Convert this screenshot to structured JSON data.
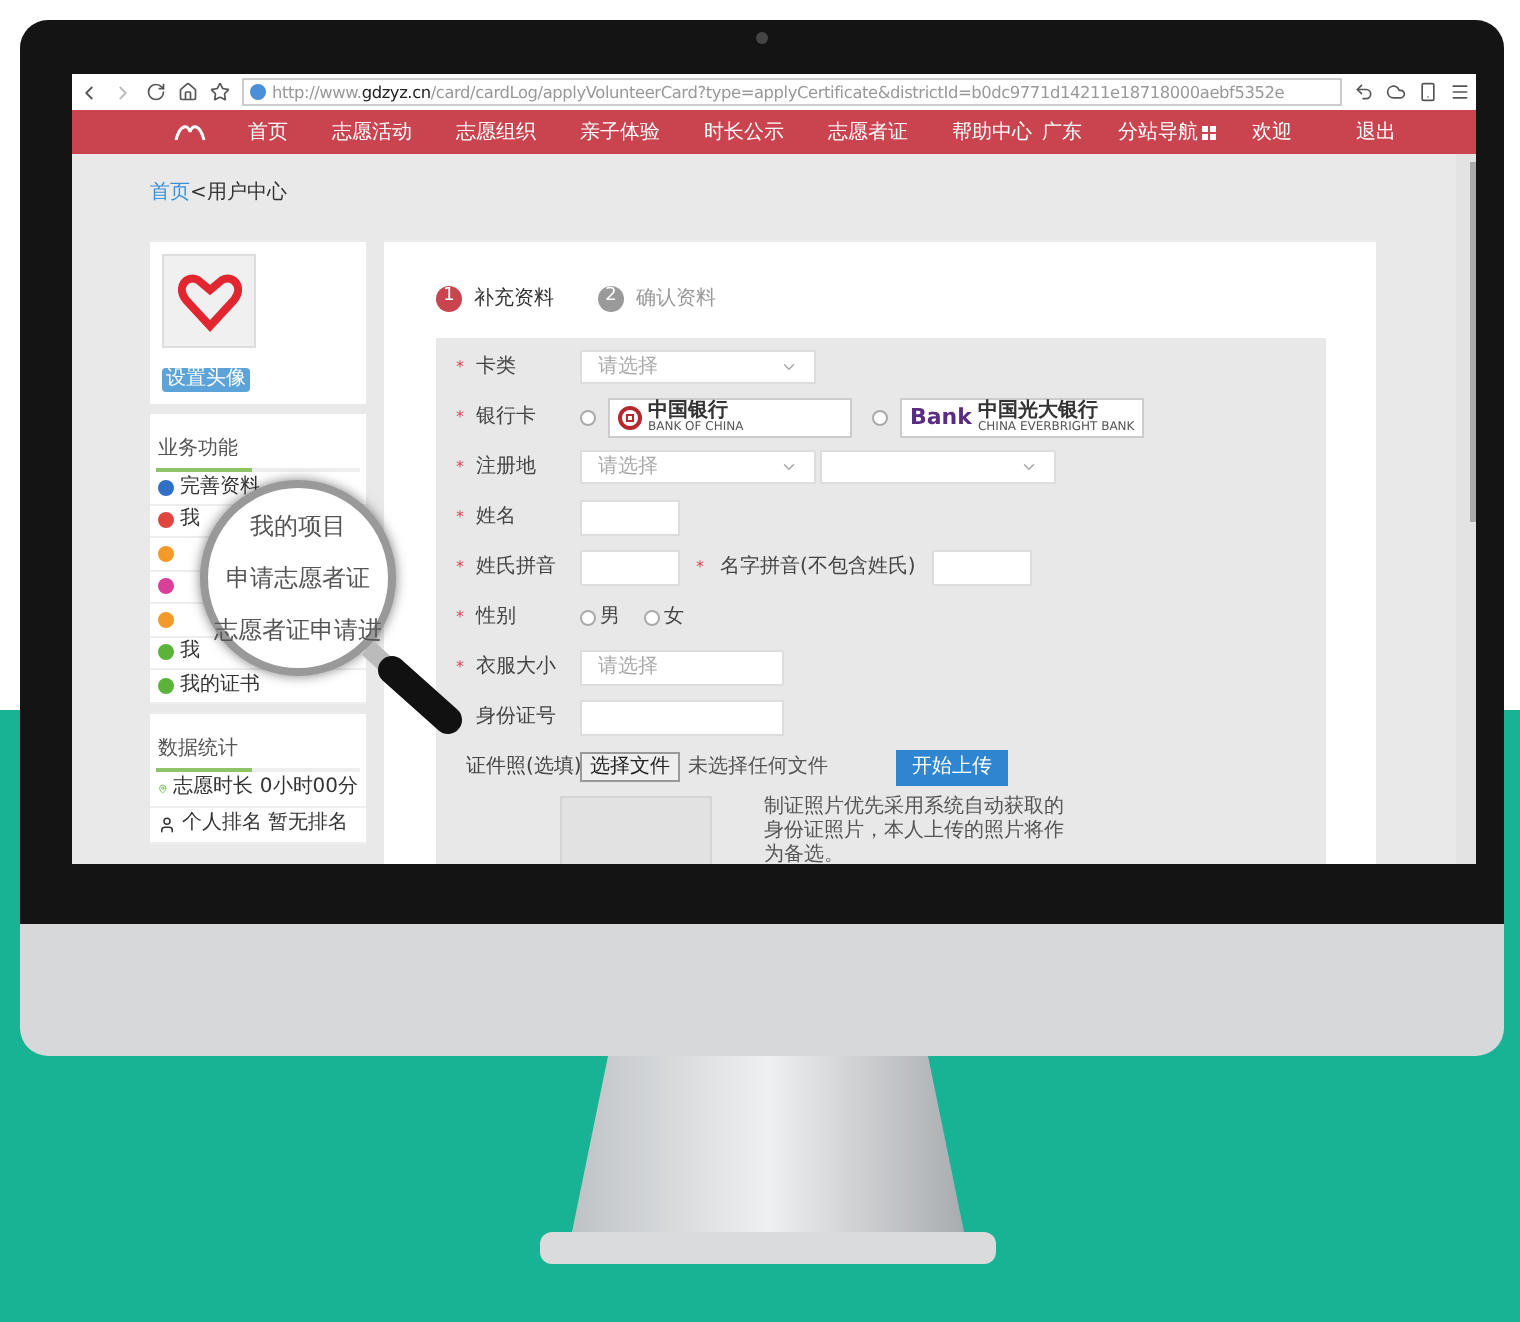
{
  "browser": {
    "url_host": "http://www.",
    "url_domain": "gdzyz.cn",
    "url_path": "/card/cardLog/applyVolunteerCard?type=applyCertificate&districtId=b0dc9771d14211e18718000aebf5352e"
  },
  "nav": {
    "items": [
      {
        "label": "首页"
      },
      {
        "label": "志愿活动"
      },
      {
        "label": "志愿组织"
      },
      {
        "label": "亲子体验"
      },
      {
        "label": "时长公示"
      },
      {
        "label": "志愿者证"
      },
      {
        "label": "帮助中心"
      }
    ],
    "region": "广东",
    "site_nav": "分站导航",
    "welcome": "欢迎",
    "logout": "退出"
  },
  "breadcrumb": {
    "home": "首页",
    "separator": "<",
    "current": "用户中心"
  },
  "profile": {
    "set_avatar": "设置头像"
  },
  "business": {
    "title": "业务功能",
    "items": [
      {
        "label": "完善资料",
        "color": "#2f6fc4"
      },
      {
        "label": "我",
        "color": "#e0463e"
      },
      {
        "color": "#f39a2b"
      },
      {
        "color": "#d9409a"
      },
      {
        "color": "#f39a2b"
      },
      {
        "label": "我",
        "color": "#5bb33a"
      },
      {
        "label": "我的证书",
        "color": "#5bb33a"
      }
    ]
  },
  "stats": {
    "title": "数据统计",
    "items": [
      {
        "kind": "pin",
        "label": "志愿时长 0小时00分"
      },
      {
        "kind": "person",
        "label": "个人排名 暂无排名"
      }
    ]
  },
  "magnifier": {
    "lines": [
      "我的项目",
      "申请志愿者证",
      "志愿者证申请进"
    ]
  },
  "steps": [
    {
      "number": "1",
      "label": "补充资料",
      "active": true
    },
    {
      "number": "2",
      "label": "确认资料",
      "active": false
    }
  ],
  "form": {
    "required_mark": "*",
    "rows": [
      {
        "kind": "select",
        "label": "卡类",
        "required": true,
        "value": "请选择"
      },
      {
        "kind": "bank",
        "label": "银行卡",
        "required": true,
        "options": [
          {
            "selected": false,
            "kind": "boc",
            "name": "中国银行",
            "sub": "BANK OF CHINA"
          },
          {
            "selected": false,
            "kind": "ceb",
            "mark": "Bank",
            "name": "中国光大银行",
            "sub": "CHINA EVERBRIGHT BANK"
          }
        ]
      },
      {
        "kind": "select2",
        "label": "注册地",
        "required": true,
        "value": "请选择"
      },
      {
        "kind": "input",
        "label": "姓名",
        "required": true
      },
      {
        "kind": "pinyin",
        "label": "姓氏拼音",
        "required": true,
        "label2": "名字拼音(不包含姓氏)"
      },
      {
        "kind": "radio",
        "label": "性别",
        "required": true,
        "options": [
          {
            "label": "男",
            "selected": false
          },
          {
            "label": "女",
            "selected": false
          }
        ]
      },
      {
        "kind": "wide",
        "label": "衣服大小",
        "required": true,
        "placeholder": "请选择"
      },
      {
        "kind": "wide",
        "label": "身份证号",
        "required": false
      },
      {
        "kind": "file",
        "label": "证件照(选填)",
        "required": false,
        "choose": "选择文件",
        "status": "未选择任何文件",
        "upload": "开始上传"
      }
    ],
    "photo_note": "制证照片优先采用系统自动获取的身份证照片，本人上传的照片将作为备选。"
  }
}
